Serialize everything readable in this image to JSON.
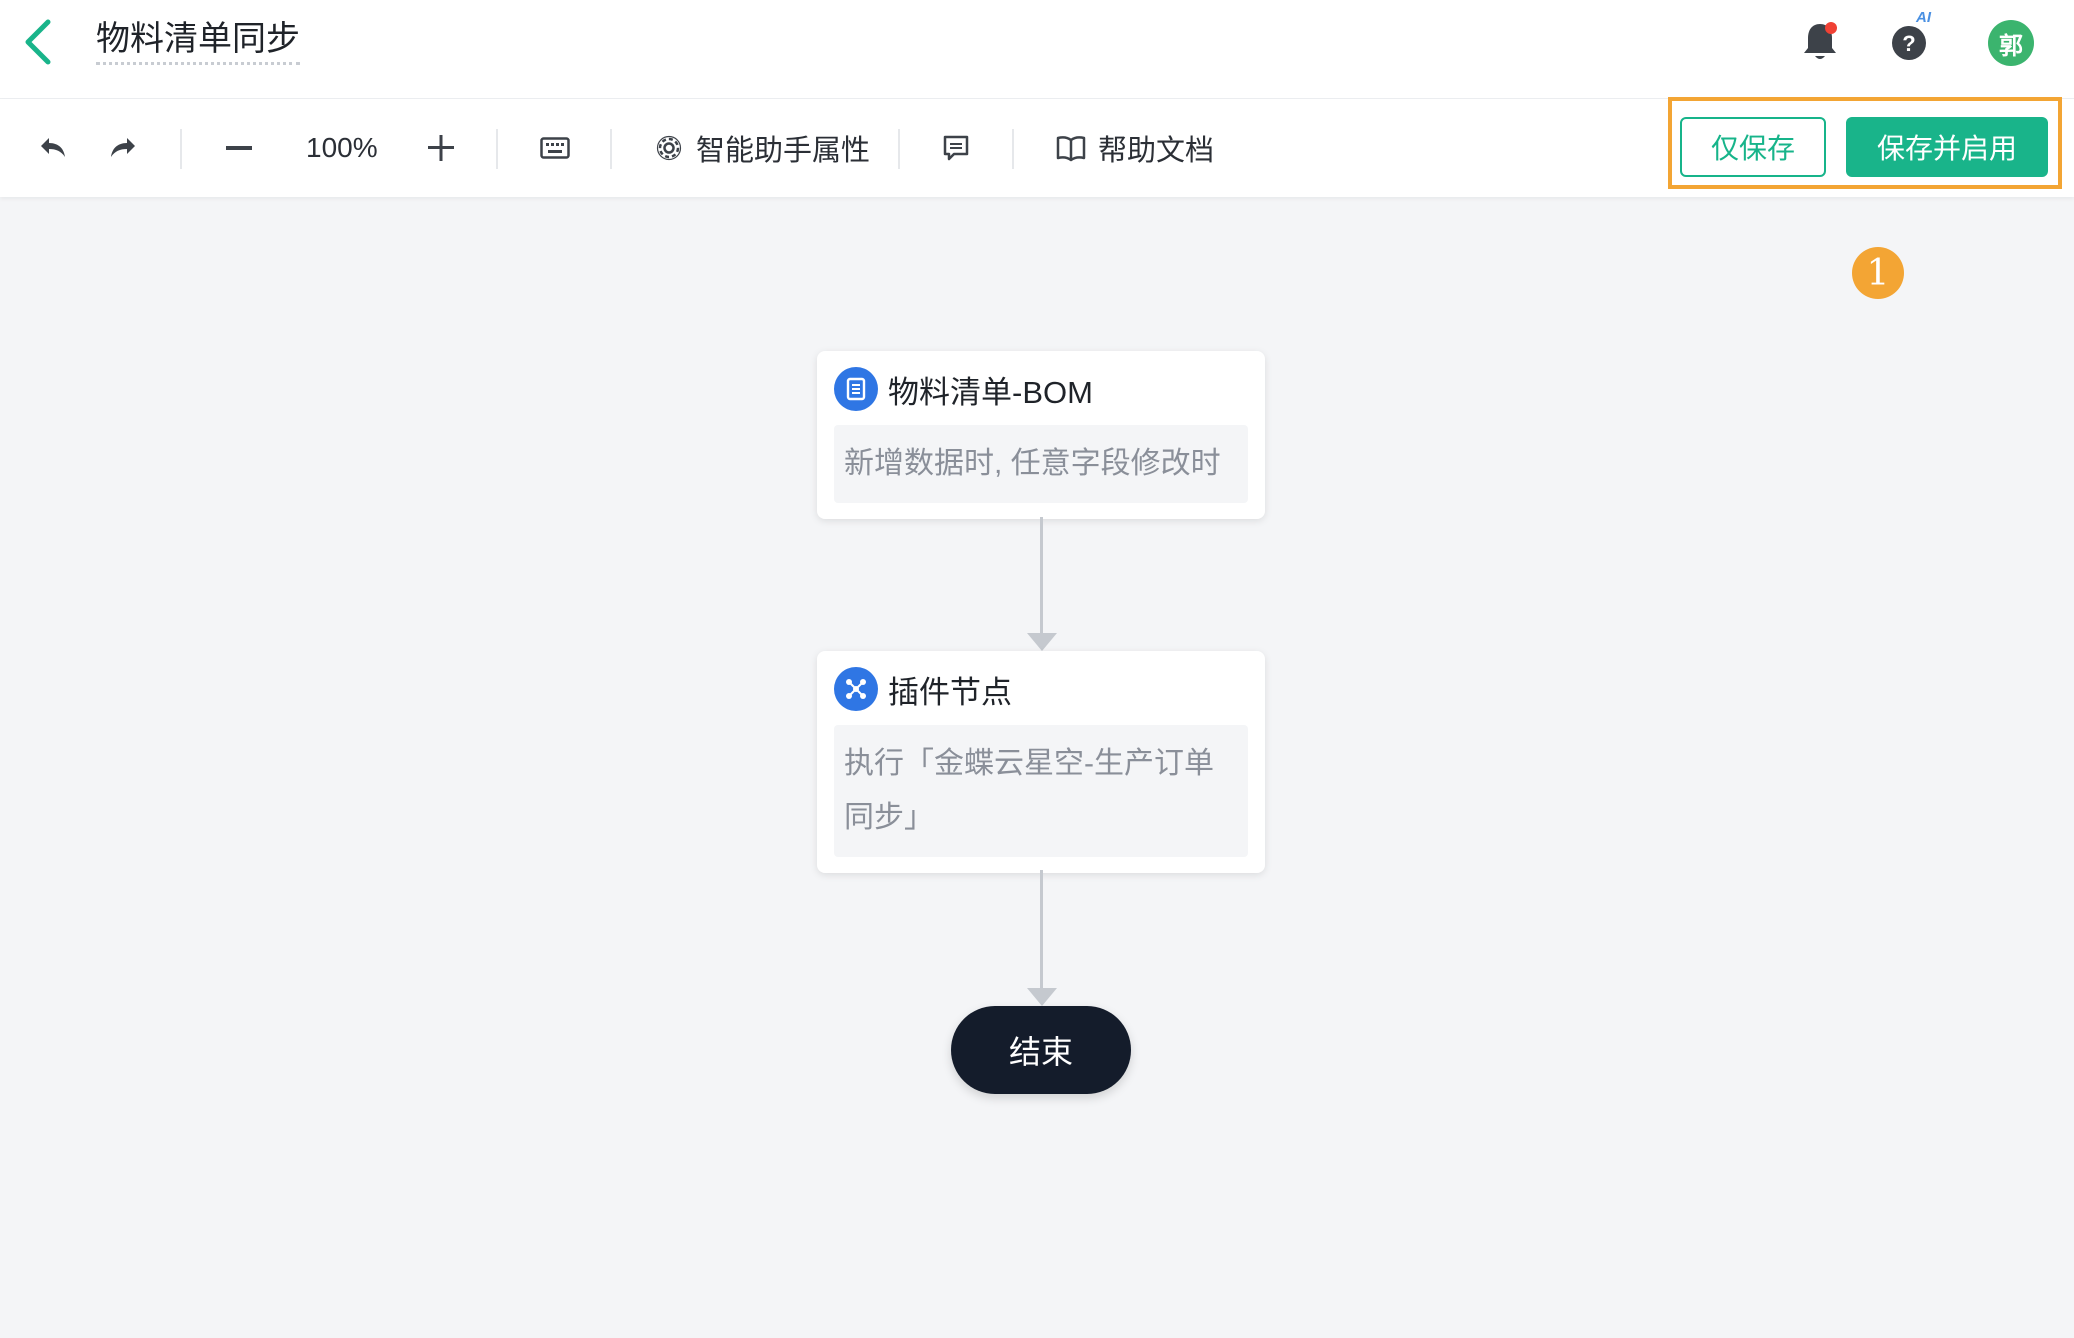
{
  "header": {
    "title": "物料清单同步",
    "ai_badge": "AI",
    "avatar_text": "郭",
    "icons": [
      "chevron-left-icon",
      "bell-icon",
      "help-icon"
    ],
    "notification_dot_color": "#f04134"
  },
  "toolbar": {
    "zoom": "100%",
    "assistant_properties": "智能助手属性",
    "help_docs": "帮助文档",
    "save_only": "仅保存",
    "save_and_enable": "保存并启用",
    "icons": [
      "undo-icon",
      "redo-icon",
      "zoom-out-icon",
      "zoom-in-icon",
      "keyboard-icon",
      "gear-icon",
      "comment-icon",
      "book-icon"
    ]
  },
  "annotation": {
    "step_number": "1",
    "highlight_color": "#f3a534"
  },
  "flow": {
    "trigger_node": {
      "title": "物料清单-BOM",
      "description": "新增数据时, 任意字段修改时",
      "icon": "form-icon"
    },
    "plugin_node": {
      "title": "插件节点",
      "description_line1": "执行「金蝶云星空-生产订单",
      "description_line2": "同步」",
      "icon": "plugin-icon"
    },
    "end_node": {
      "label": "结束"
    }
  },
  "colors": {
    "accent": "#19b48a",
    "node_icon": "#2f76e4",
    "end_node": "#141c2b",
    "canvas_bg": "#f4f5f7"
  }
}
